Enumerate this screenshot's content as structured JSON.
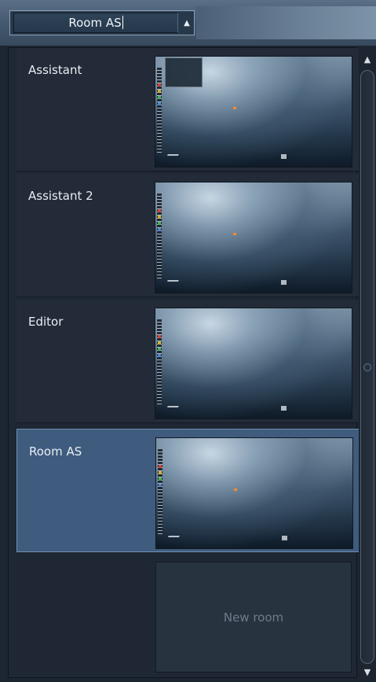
{
  "toolbar": {
    "room_name": "Room AS",
    "toggle_icon": "up-arrow-icon"
  },
  "rooms": [
    {
      "label": "Assistant",
      "selected": false,
      "thumbnail_has_panel": true
    },
    {
      "label": "Assistant 2",
      "selected": false,
      "thumbnail_has_panel": false
    },
    {
      "label": "Editor",
      "selected": false,
      "thumbnail_has_panel": false
    },
    {
      "label": "Room AS",
      "selected": true,
      "thumbnail_has_panel": false
    }
  ],
  "new_room": {
    "label": "New room"
  },
  "scrollbar": {
    "up_icon": "up-arrow-icon",
    "down_icon": "down-arrow-icon"
  },
  "colors": {
    "selected_row": "#3f5c7e",
    "accent_dot": "#ff8a2a"
  }
}
